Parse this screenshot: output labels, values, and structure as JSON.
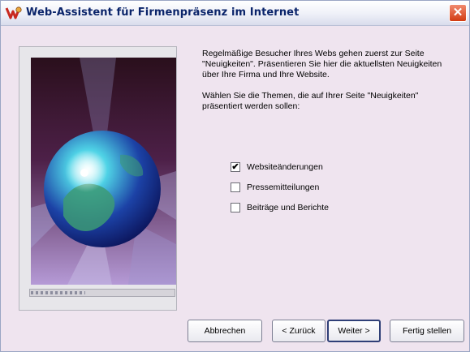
{
  "window": {
    "title": "Web-Assistent für Firmenpräsenz im Internet",
    "close_label": "✕"
  },
  "intro": {
    "paragraph1": "Regelmäßige Besucher Ihres Webs gehen zuerst zur Seite \"Neuigkeiten\". Präsentieren Sie hier die aktuellsten Neuigkeiten über Ihre Firma und Ihre Website.",
    "paragraph2": "Wählen Sie die Themen, die auf Ihrer Seite \"Neuigkeiten\" präsentiert werden sollen:"
  },
  "topics": [
    {
      "label": "Websiteänderungen",
      "checked": true
    },
    {
      "label": "Pressemitteilungen",
      "checked": false
    },
    {
      "label": "Beiträge und Berichte",
      "checked": false
    }
  ],
  "check_mark": "✔",
  "buttons": {
    "cancel": "Abbrechen",
    "back": "< Zurück",
    "next": "Weiter >",
    "finish": "Fertig stellen"
  },
  "progress": {
    "value": 0.38
  },
  "colors": {
    "title_text": "#0a246a",
    "dialog_bg": "#efe4ef",
    "close_button": "#d23b12"
  },
  "icons": {
    "app": "frontpage-wizard-icon",
    "close": "close-icon"
  }
}
